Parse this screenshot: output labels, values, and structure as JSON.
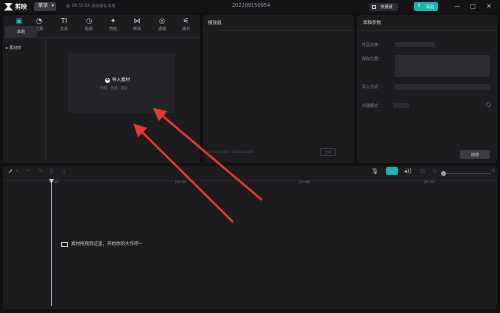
{
  "titlebar": {
    "app_name": "剪映",
    "menu_label": "菜单",
    "autosave_text": "09:55:04 自动保存本地",
    "project_title": "202209150954",
    "shortcut_label": "快捷键",
    "export_label": "导出",
    "window_controls": [
      "—",
      "□",
      "✕"
    ]
  },
  "media": {
    "tabs": [
      {
        "label": "媒体",
        "icon": "media-icon",
        "glyph": "▣",
        "active": true
      },
      {
        "label": "音频",
        "icon": "audio-icon",
        "glyph": "◔",
        "active": false
      },
      {
        "label": "文本",
        "icon": "text-icon",
        "glyph": "TI",
        "active": false
      },
      {
        "label": "贴纸",
        "icon": "sticker-icon",
        "glyph": "◷",
        "active": false
      },
      {
        "label": "特效",
        "icon": "effects-icon",
        "glyph": "✦",
        "active": false
      },
      {
        "label": "转场",
        "icon": "transition-icon",
        "glyph": "⋈",
        "active": false
      },
      {
        "label": "滤镜",
        "icon": "filter-icon",
        "glyph": "◎",
        "active": false
      },
      {
        "label": "调节",
        "icon": "adjust-icon",
        "glyph": "⚟",
        "active": false
      }
    ],
    "side_local": "本地",
    "side_library": "▸ 素材库",
    "import_label": "导入素材",
    "import_hint": "视频、音频、图片"
  },
  "player": {
    "title": "播放器",
    "timecode": "00:00:00:00 / 00:00:00:00",
    "ratio_label": "比例"
  },
  "draft": {
    "title": "草稿参数",
    "labels": [
      "作品名称：",
      "保存位置：",
      "导入方式：",
      "代理模式："
    ],
    "edit_label": "修改"
  },
  "timeline": {
    "tick_labels": [
      "00:00",
      "|10:00",
      "|20:00",
      "|30:00"
    ],
    "drop_hint": "素材拖拽到这里，开始你的大作吧~",
    "toolbar_icons": [
      "cursor-icon",
      "undo-icon",
      "redo-icon",
      "split-icon",
      "delete-icon",
      "mic-icon",
      "link-icon",
      "audio-track-icon",
      "zoom-out-icon",
      "zoom-in-icon"
    ]
  },
  "colors": {
    "accent": "#1cc7c1",
    "annotation_arrow": "#e53935"
  }
}
